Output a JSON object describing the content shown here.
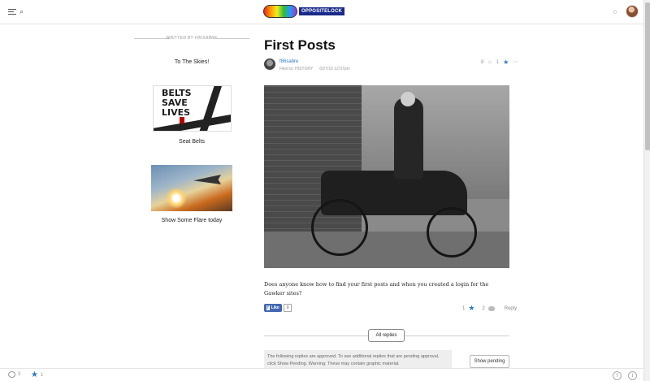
{
  "header": {
    "logo_text": "OPPOSITELOCK",
    "notification_count": "0"
  },
  "sidebar": {
    "written_by": "WRITTEN BY F86SABRE",
    "items": [
      {
        "title": "To The Skies!"
      },
      {
        "title": "Seat Belts",
        "thumb_text": "BELTS SAVE LIVES"
      },
      {
        "title": "Show Some Flare today"
      }
    ]
  },
  "post": {
    "title": "First Posts",
    "author": "f86sabre",
    "filed_to": "Filed to: HISTORY",
    "date": "6/27/15 12:07pm",
    "views": "8",
    "stars": "1",
    "body": "Does anyone know how to find your first posts and when you created a login for the Gawker sites?"
  },
  "engagement": {
    "fb_like_label": "Like",
    "fb_count": "0",
    "star_count": "1",
    "reply_count": "2",
    "reply_label": "Reply"
  },
  "replies": {
    "all_replies_label": "All replies",
    "pending_note": "The following replies are approved. To see additional replies that are pending approval, click Show Pending. Warning: These may contain graphic material.",
    "show_pending_label": "Show pending"
  },
  "bottom_bar": {
    "comments": "3",
    "stars": "1"
  },
  "colors": {
    "accent": "#2a7ac8",
    "facebook": "#4267b2"
  }
}
